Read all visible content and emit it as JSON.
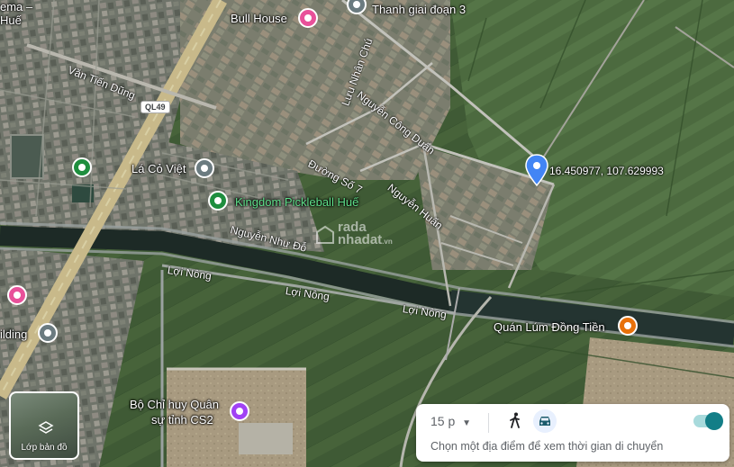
{
  "places": {
    "cinema_partial": "ema –",
    "hue_partial": "Huế",
    "bull_house": "Bull House",
    "thanh_giai_doan": "Thanh giai đoạn 3",
    "la_co_viet": "Lá Cỏ Việt",
    "kingdom_pickleball": "Kingdom Pickleball Huế",
    "building_partial": "ilding",
    "quan_lum_dong_tien": "Quán Lúm Đồng Tiền",
    "bo_chi_huy_line1": "Bộ Chỉ huy Quân",
    "bo_chi_huy_line2": "sự tỉnh CS2",
    "dropped_pin_coords": "16.450977, 107.629993"
  },
  "streets": {
    "van_tien_dung": "Văn Tiến Dũng",
    "luu_nhan_chu": "Lưu Nhân Chú",
    "nguyen_cong_duan": "Nguyễn Công Duẩn",
    "duong_so_7": "Đường Số 7",
    "nguyen_huan": "Nguyễn Huấn",
    "nguyen_nhu_do": "Nguyễn Như Đỗ",
    "loi_nong_1": "Lợi Nông",
    "loi_nong_2": "Lợi Nông",
    "loi_nong_3": "Lợi Nông",
    "highway_badge": "QL49"
  },
  "watermark": {
    "line1": "rada",
    "line2": "nhadat",
    "suffix": ".vn"
  },
  "layer_button": {
    "label": "Lớp bản đồ"
  },
  "travel_panel": {
    "time": "15 p",
    "hint": "Chọn một địa điểm để xem thời gian di chuyển",
    "mode_selected": "car",
    "toggle_on": true
  },
  "colors": {
    "pin_blue": "#4285f4",
    "pin_green": "#1e8e3e",
    "pin_pink": "#e8519a",
    "pin_purple": "#a142f4",
    "pin_orange": "#e8710a",
    "toggle_accent": "#137e87"
  }
}
